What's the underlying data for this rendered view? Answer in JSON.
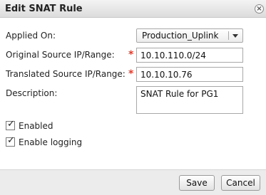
{
  "dialog": {
    "title": "Edit SNAT Rule",
    "close_icon": "close-icon",
    "close_glyph": "×"
  },
  "form": {
    "applied_on": {
      "label": "Applied On:",
      "value": "Production_Uplink"
    },
    "original_source": {
      "label": "Original Source IP/Range:",
      "required_mark": "*",
      "value": "10.10.110.0/24"
    },
    "translated_source": {
      "label": "Translated Source IP/Range:",
      "required_mark": "*",
      "value": "10.10.10.76"
    },
    "description": {
      "label": "Description:",
      "value": "SNAT Rule for PG1"
    },
    "enabled": {
      "label": "Enabled",
      "checked": true,
      "mark": "✓"
    },
    "enable_logging": {
      "label": "Enable logging",
      "checked": true,
      "mark": "✓"
    }
  },
  "footer": {
    "save_label": "Save",
    "cancel_label": "Cancel"
  },
  "colors": {
    "required": "#e03a2c",
    "titlebar": "#dcdcdc",
    "footer": "#ececec"
  }
}
